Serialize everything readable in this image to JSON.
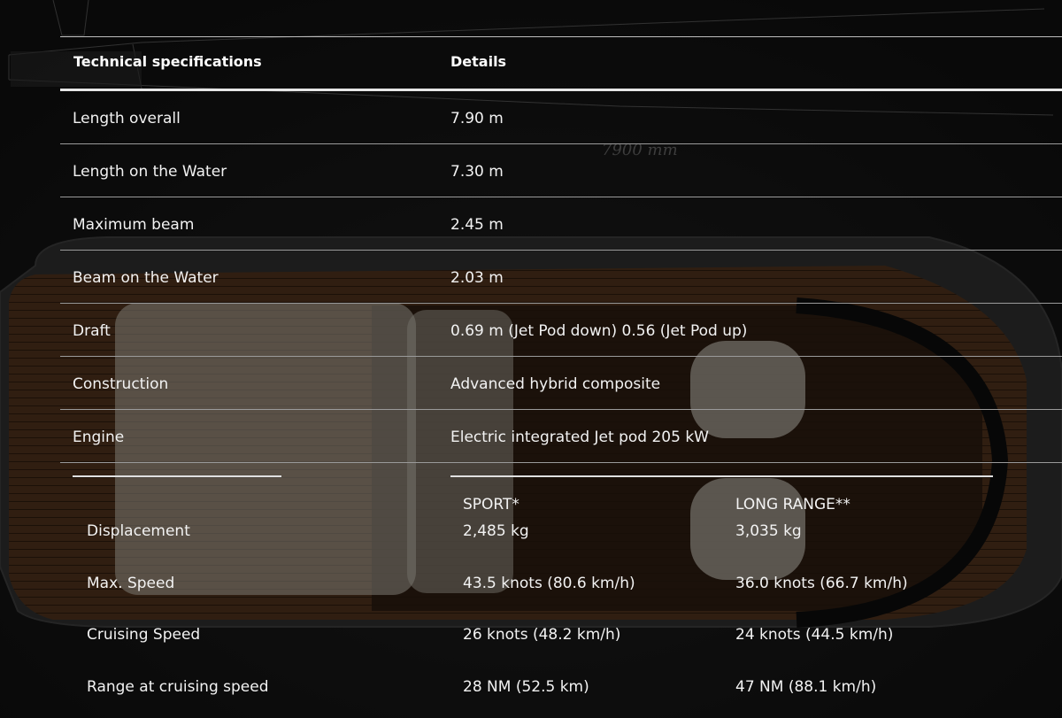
{
  "background": {
    "dimension_mark": "7900 mm",
    "hull_color": "#5a3a22",
    "deck_color": "#2c1d12",
    "cushion_color": "#c9c6bd"
  },
  "table": {
    "header_label": "Technical specifications",
    "header_value": "Details",
    "rows": [
      {
        "label": "Length overall",
        "value": "7.90 m"
      },
      {
        "label": "Length on the Water",
        "value": "7.30 m"
      },
      {
        "label": "Maximum beam",
        "value": "2.45 m"
      },
      {
        "label": "Beam on the Water",
        "value": "2.03 m"
      },
      {
        "label": "Draft",
        "value": "0.69 m (Jet Pod down) 0.56 (Jet Pod up)"
      },
      {
        "label": "Construction",
        "value": "Advanced hybrid composite"
      },
      {
        "label": "Engine",
        "value": "Electric integrated Jet pod 205 kW"
      }
    ]
  },
  "subtable": {
    "col1": "SPORT*",
    "col2": "LONG RANGE**",
    "rows": [
      {
        "label": "Displacement",
        "sport": "2,485 kg",
        "long_range": "3,035 kg"
      },
      {
        "label": "Max. Speed",
        "sport": "43.5 knots (80.6 km/h)",
        "long_range": "36.0 knots (66.7 km/h)"
      },
      {
        "label": "Cruising Speed",
        "sport": "26 knots (48.2 km/h)",
        "long_range": "24 knots (44.5 km/h)"
      },
      {
        "label": "Range at cruising speed",
        "sport": "28 NM (52.5 km)",
        "long_range": "47 NM (88.1 km/h)"
      }
    ]
  }
}
